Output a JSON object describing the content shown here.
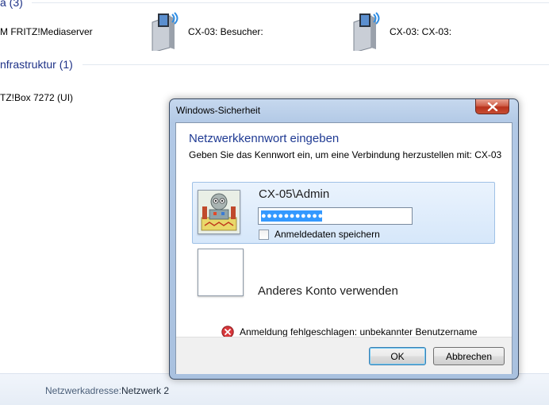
{
  "explorer": {
    "group_media_header": "a (3)",
    "media_items": [
      {
        "label": "M FRITZ!Mediaserver",
        "icon": "media-server-icon"
      },
      {
        "label": "CX-03: Besucher:",
        "icon": "media-server-icon"
      },
      {
        "label": "CX-03: CX-03:",
        "icon": "media-server-icon"
      }
    ],
    "group_infra_header": "nfrastruktur (1)",
    "infra_items": [
      {
        "label": "TZ!Box 7272 (UI)"
      }
    ],
    "status": {
      "key": "Netzwerkadresse:",
      "value": "Netzwerk  2"
    }
  },
  "dialog": {
    "title": "Windows-Sicherheit",
    "heading": "Netzwerkkennwort eingeben",
    "subtext": "Geben Sie das Kennwort ein, um eine Verbindung herzustellen mit: CX-03",
    "credential": {
      "user": "CX-05\\Admin",
      "password_mask": "●●●●●●●●●●●",
      "remember_label": "Anmeldedaten speichern",
      "remember_checked": false
    },
    "other_account_label": "Anderes Konto verwenden",
    "error_text": "Anmeldung fehlgeschlagen: unbekannter Benutzername oder falsches Kennwort.",
    "ok_label": "OK",
    "cancel_label": "Abbrechen"
  },
  "colors": {
    "heading": "#1f3a93",
    "selection": "#3399ff",
    "close_button": "#c74e34"
  }
}
